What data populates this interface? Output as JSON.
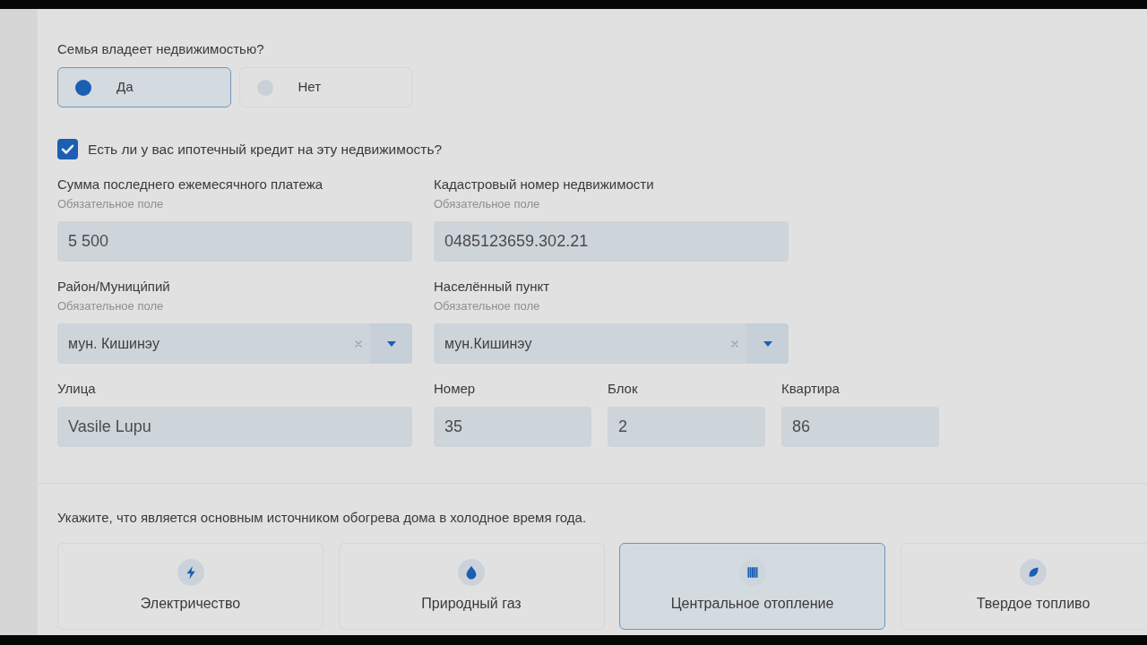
{
  "property": {
    "question": "Семья владеет недвижимостью?",
    "options": [
      {
        "label": "Да",
        "selected": true
      },
      {
        "label": "Нет",
        "selected": false
      }
    ]
  },
  "mortgage": {
    "label": "Есть ли у вас ипотечный кредит на эту недвижимость?",
    "checked": true
  },
  "form_rows": [
    [
      {
        "kind": "input",
        "label": "Сумма последнего ежемесячного платежа",
        "hint": "Обязательное поле",
        "value": "5 500"
      },
      {
        "kind": "input",
        "label": "Кадастровый номер недвижимости",
        "hint": "Обязательное поле",
        "value": "0485123659.302.21"
      }
    ],
    [
      {
        "kind": "select",
        "label": "Район/Муници́пий",
        "hint": "Обязательное поле",
        "value": "мун. Кишинэу"
      },
      {
        "kind": "select",
        "label": "Населённый пункт",
        "hint": "Обязательное поле",
        "value": "мун.Кишинэу"
      }
    ],
    [
      {
        "kind": "input",
        "label": "Улица",
        "value": "Vasile Lupu"
      },
      {
        "kind": "input",
        "label": "Номер",
        "value": "35"
      },
      {
        "kind": "input",
        "label": "Блок",
        "value": "2"
      },
      {
        "kind": "input",
        "label": "Квартира",
        "value": "86"
      }
    ]
  ],
  "heating": {
    "question": "Укажите, что является основным источником обогрева дома в холодное время года.",
    "options": [
      {
        "label": "Электричество",
        "selected": false
      },
      {
        "label": "Природный газ",
        "selected": false
      },
      {
        "label": "Центральное отопление",
        "selected": true
      },
      {
        "label": "Твердое топливо",
        "selected": false
      }
    ]
  }
}
